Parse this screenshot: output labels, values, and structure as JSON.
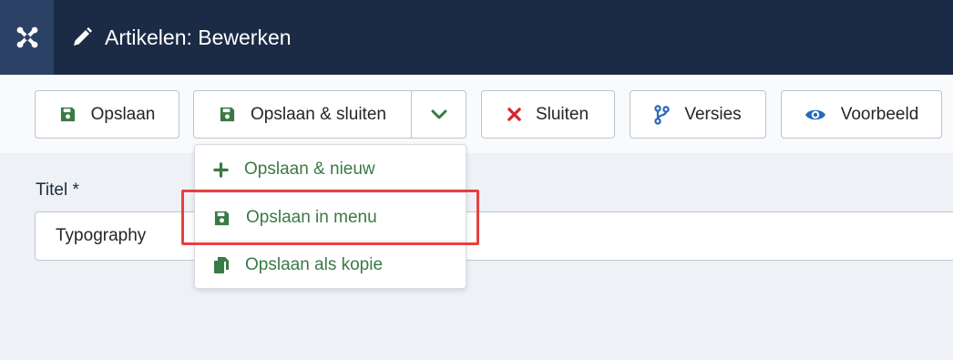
{
  "header": {
    "title": "Artikelen: Bewerken",
    "logo_icon": "joomla-icon",
    "title_icon": "pencil-icon"
  },
  "toolbar": {
    "save_label": "Opslaan",
    "save_close_label": "Opslaan & sluiten",
    "close_label": "Sluiten",
    "versions_label": "Versies",
    "preview_label": "Voorbeeld"
  },
  "dropdown": {
    "items": [
      {
        "label": "Opslaan & nieuw",
        "icon": "plus-icon"
      },
      {
        "label": "Opslaan in menu",
        "icon": "save-icon",
        "highlighted": true
      },
      {
        "label": "Opslaan als kopie",
        "icon": "copy-icon"
      }
    ]
  },
  "form": {
    "title_label": "Titel *",
    "title_value": "Typography"
  },
  "colors": {
    "header_bg": "#1c2b45",
    "logo_bg": "#2b4166",
    "green": "#3a7a45",
    "close_red": "#d9262e",
    "accent_blue": "#2a69b8",
    "highlight_red": "#e8403f"
  }
}
